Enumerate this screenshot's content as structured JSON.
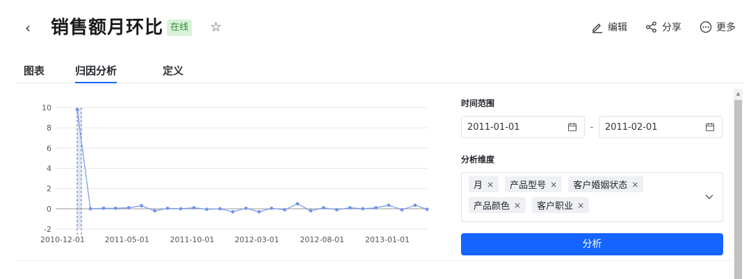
{
  "header": {
    "back_glyph": "‹",
    "title": "销售额月环比",
    "status": "在线",
    "star_glyph": "☆",
    "actions": [
      {
        "label": "编辑",
        "icon": "edit-icon"
      },
      {
        "label": "分享",
        "icon": "share-icon"
      },
      {
        "label": "更多",
        "icon": "more-icon"
      }
    ]
  },
  "tabs": [
    {
      "label": "图表",
      "active": false
    },
    {
      "label": "归因分析",
      "active": true
    },
    {
      "label": "定义",
      "active": false
    }
  ],
  "panel": {
    "time_range_label": "时间范围",
    "date_start": "2011-01-01",
    "date_separator": "-",
    "date_end": "2011-02-01",
    "dimension_label": "分析维度",
    "dimensions": [
      "月",
      "产品型号",
      "客户婚姻状态",
      "产品颜色",
      "客户职业"
    ],
    "tag_remove_glyph": "×",
    "analyze_label": "分析"
  },
  "colors": {
    "accent": "#1664ff",
    "line": "#6f95e8",
    "highlight": "#d3e1fb"
  },
  "chart_data": {
    "type": "line",
    "title": "",
    "xlabel": "",
    "ylabel": "",
    "ylim": [
      -2,
      10
    ],
    "yticks": [
      10,
      8,
      6,
      4,
      2,
      0,
      -2
    ],
    "xtick_labels": [
      "2010-12-01",
      "2011-05-01",
      "2011-10-01",
      "2012-03-01",
      "2012-08-01",
      "2013-01-01"
    ],
    "grid": true,
    "highlight_range": [
      "2010-12-01",
      "2011-01-01"
    ],
    "x": [
      "2010-12-01",
      "2011-01-01",
      "2011-02-01",
      "2011-03-01",
      "2011-04-01",
      "2011-05-01",
      "2011-06-01",
      "2011-07-01",
      "2011-08-01",
      "2011-09-01",
      "2011-10-01",
      "2011-11-01",
      "2011-12-01",
      "2012-01-01",
      "2012-02-01",
      "2012-03-01",
      "2012-04-01",
      "2012-05-01",
      "2012-06-01",
      "2012-07-01",
      "2012-08-01",
      "2012-09-01",
      "2012-10-01",
      "2012-11-01",
      "2012-12-01",
      "2013-01-01",
      "2013-02-01",
      "2013-03-01",
      "2013-04-01",
      "2013-05-01"
    ],
    "series": [
      {
        "values": [
          9.8,
          0.0,
          0.05,
          0.05,
          0.1,
          0.3,
          -0.2,
          0.05,
          0.0,
          0.1,
          -0.05,
          0.0,
          -0.3,
          0.05,
          -0.3,
          0.05,
          -0.1,
          0.5,
          -0.2,
          0.1,
          -0.1,
          0.1,
          0.0,
          0.1,
          0.35,
          -0.1,
          0.35,
          -0.05,
          null,
          null
        ]
      }
    ]
  }
}
